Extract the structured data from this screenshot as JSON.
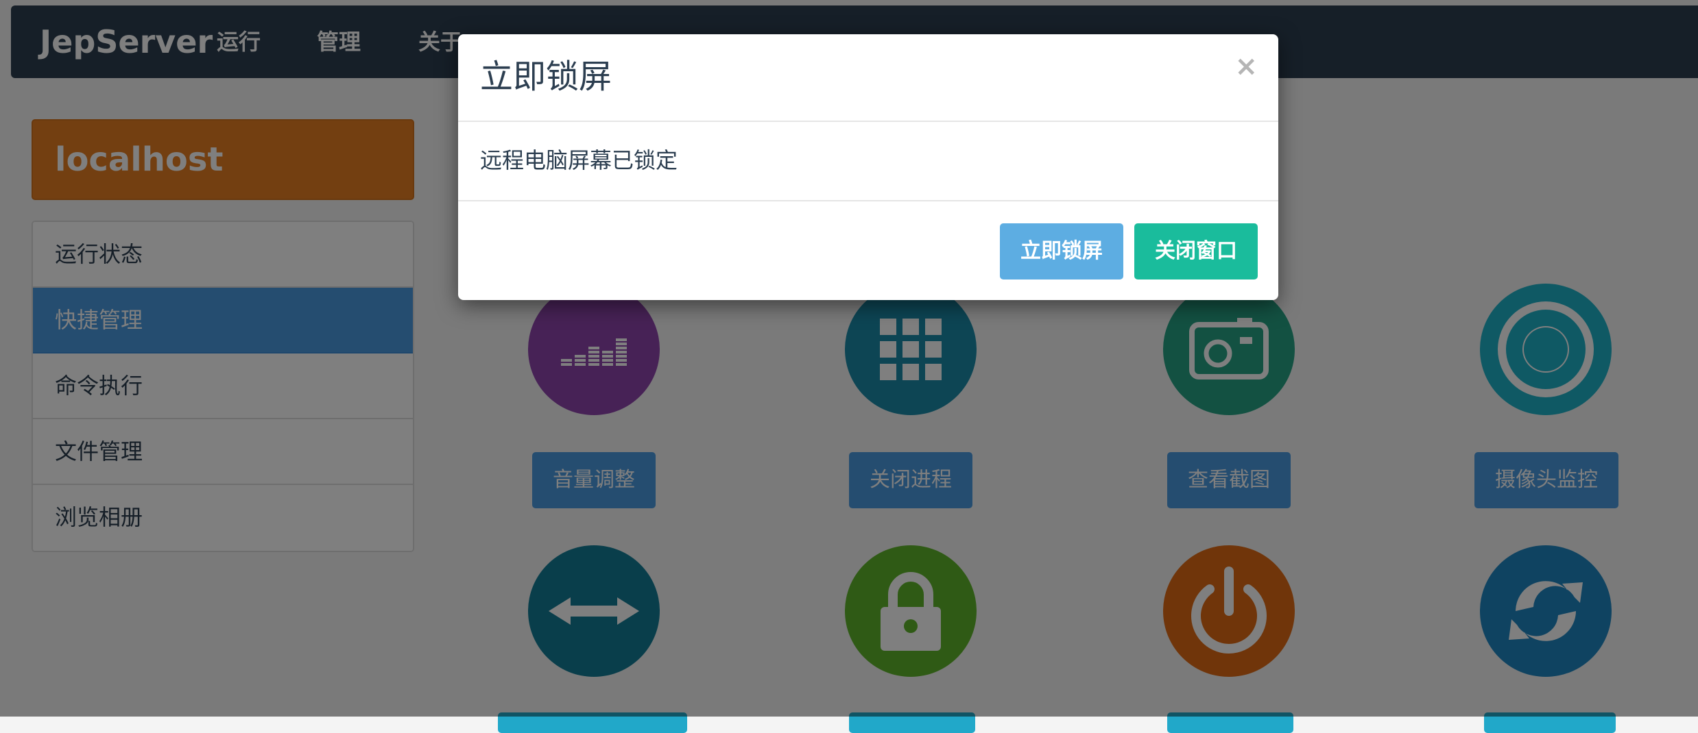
{
  "navbar": {
    "brand": "JepServer",
    "items": [
      {
        "label": "运行"
      },
      {
        "label": "管理"
      },
      {
        "label": "关于"
      }
    ]
  },
  "sidebar": {
    "host": "localhost",
    "items": [
      {
        "label": "运行状态",
        "active": false
      },
      {
        "label": "快捷管理",
        "active": true
      },
      {
        "label": "命令执行",
        "active": false
      },
      {
        "label": "文件管理",
        "active": false
      },
      {
        "label": "浏览相册",
        "active": false
      }
    ]
  },
  "tiles": [
    {
      "label": "音量调整",
      "icon": "equalizer-icon",
      "color": "#8e44ad"
    },
    {
      "label": "关闭进程",
      "icon": "grid-icon",
      "color": "#1a8aa8"
    },
    {
      "label": "查看截图",
      "icon": "camera-icon",
      "color": "#26a385"
    },
    {
      "label": "摄像头监控",
      "icon": "record-icon",
      "color": "#1fb3c9"
    },
    {
      "label": "",
      "icon": "arrows-horizontal-icon",
      "color": "#137c96"
    },
    {
      "label": "",
      "icon": "lock-icon",
      "color": "#5fb52a"
    },
    {
      "label": "",
      "icon": "power-icon",
      "color": "#e06a14"
    },
    {
      "label": "",
      "icon": "refresh-icon",
      "color": "#1f86c2"
    }
  ],
  "modal": {
    "title": "立即锁屏",
    "close_glyph": "×",
    "message": "远程电脑屏幕已锁定",
    "confirm_label": "立即锁屏",
    "dismiss_label": "关闭窗口"
  },
  "colors": {
    "navbar": "#2c3e50",
    "host_panel": "#e67e22",
    "primary": "#4a9ae0",
    "confirm_button": "#5dade2",
    "dismiss_button": "#1abc9c"
  }
}
